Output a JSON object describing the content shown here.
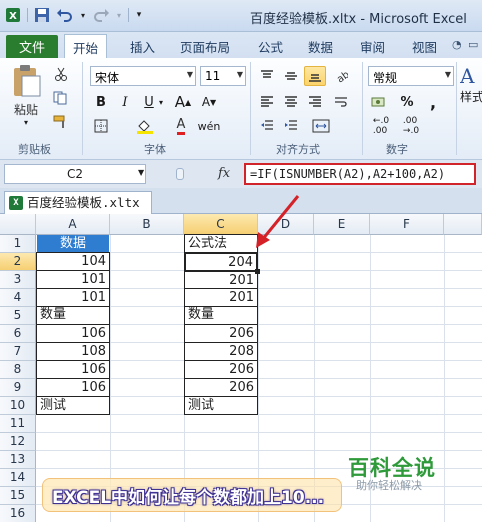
{
  "window": {
    "title": "百度经验模板.xltx - Microsoft Excel"
  },
  "ribbon_tabs": [
    "文件",
    "开始",
    "插入",
    "页面布局",
    "公式",
    "数据",
    "审阅",
    "视图"
  ],
  "active_tab": "开始",
  "ribbon": {
    "paste_label": "粘贴",
    "font_name": "宋体",
    "font_size": "11",
    "number_format": "常规",
    "style_label": "样式",
    "group_labels": {
      "clipboard": "剪贴板",
      "font": "字体",
      "alignment": "对齐方式",
      "number": "数字"
    }
  },
  "formula_bar": {
    "name_box": "C2",
    "fx": "fx",
    "formula": "=IF(ISNUMBER(A2),A2+100,A2)"
  },
  "workbook_tab": "百度经验模板.xltx",
  "columns": [
    "A",
    "B",
    "C",
    "D",
    "E",
    "F"
  ],
  "rows": [
    "1",
    "2",
    "3",
    "4",
    "5",
    "6",
    "7",
    "8",
    "9",
    "10",
    "11",
    "12",
    "13",
    "14",
    "15",
    "16"
  ],
  "column_a": [
    "数据",
    "104",
    "101",
    "101",
    "数量",
    "106",
    "108",
    "106",
    "106",
    "测试"
  ],
  "column_c": [
    "公式法",
    "204",
    "201",
    "201",
    "数量",
    "206",
    "208",
    "206",
    "206",
    "测试"
  ],
  "watermark": {
    "title": "百科全说",
    "subtitle": "助你轻松解决"
  },
  "banner": "EXCEL中如何让每个数都加上10..."
}
